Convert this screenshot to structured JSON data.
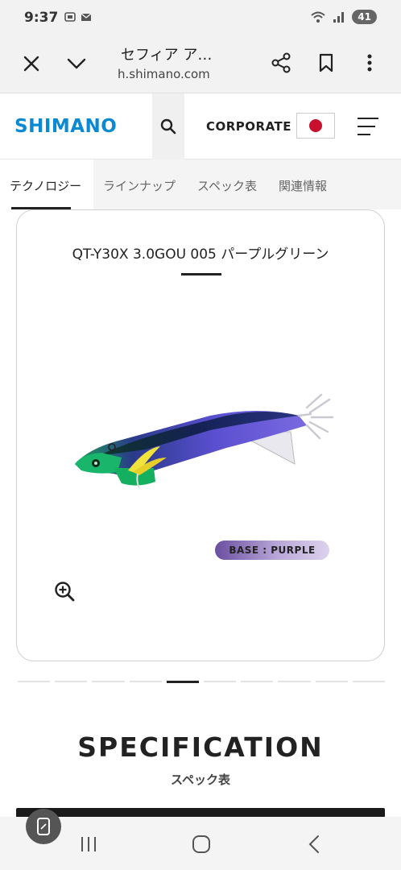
{
  "status_bar": {
    "time": "9:37",
    "battery": "41"
  },
  "browser": {
    "title": "セフィア ア…",
    "url": "h.shimano.com"
  },
  "header": {
    "logo": "SHIMANO",
    "corporate": "CORPORATE"
  },
  "tabs": [
    {
      "label": "テクノロジー",
      "active": true
    },
    {
      "label": "ラインナップ",
      "active": false
    },
    {
      "label": "スペック表",
      "active": false
    },
    {
      "label": "関連情報",
      "active": false
    }
  ],
  "product": {
    "title": "QT-Y30X 3.0GOU 005 パープルグリーン",
    "base_badge": "BASE : PURPLE"
  },
  "pager": {
    "count": 10,
    "active_index": 4
  },
  "specification": {
    "title": "SPECIFICATION",
    "subtitle": "スペック表"
  },
  "colors": {
    "logo_blue": "#0a8ad2",
    "flag_red": "#c8102e"
  }
}
